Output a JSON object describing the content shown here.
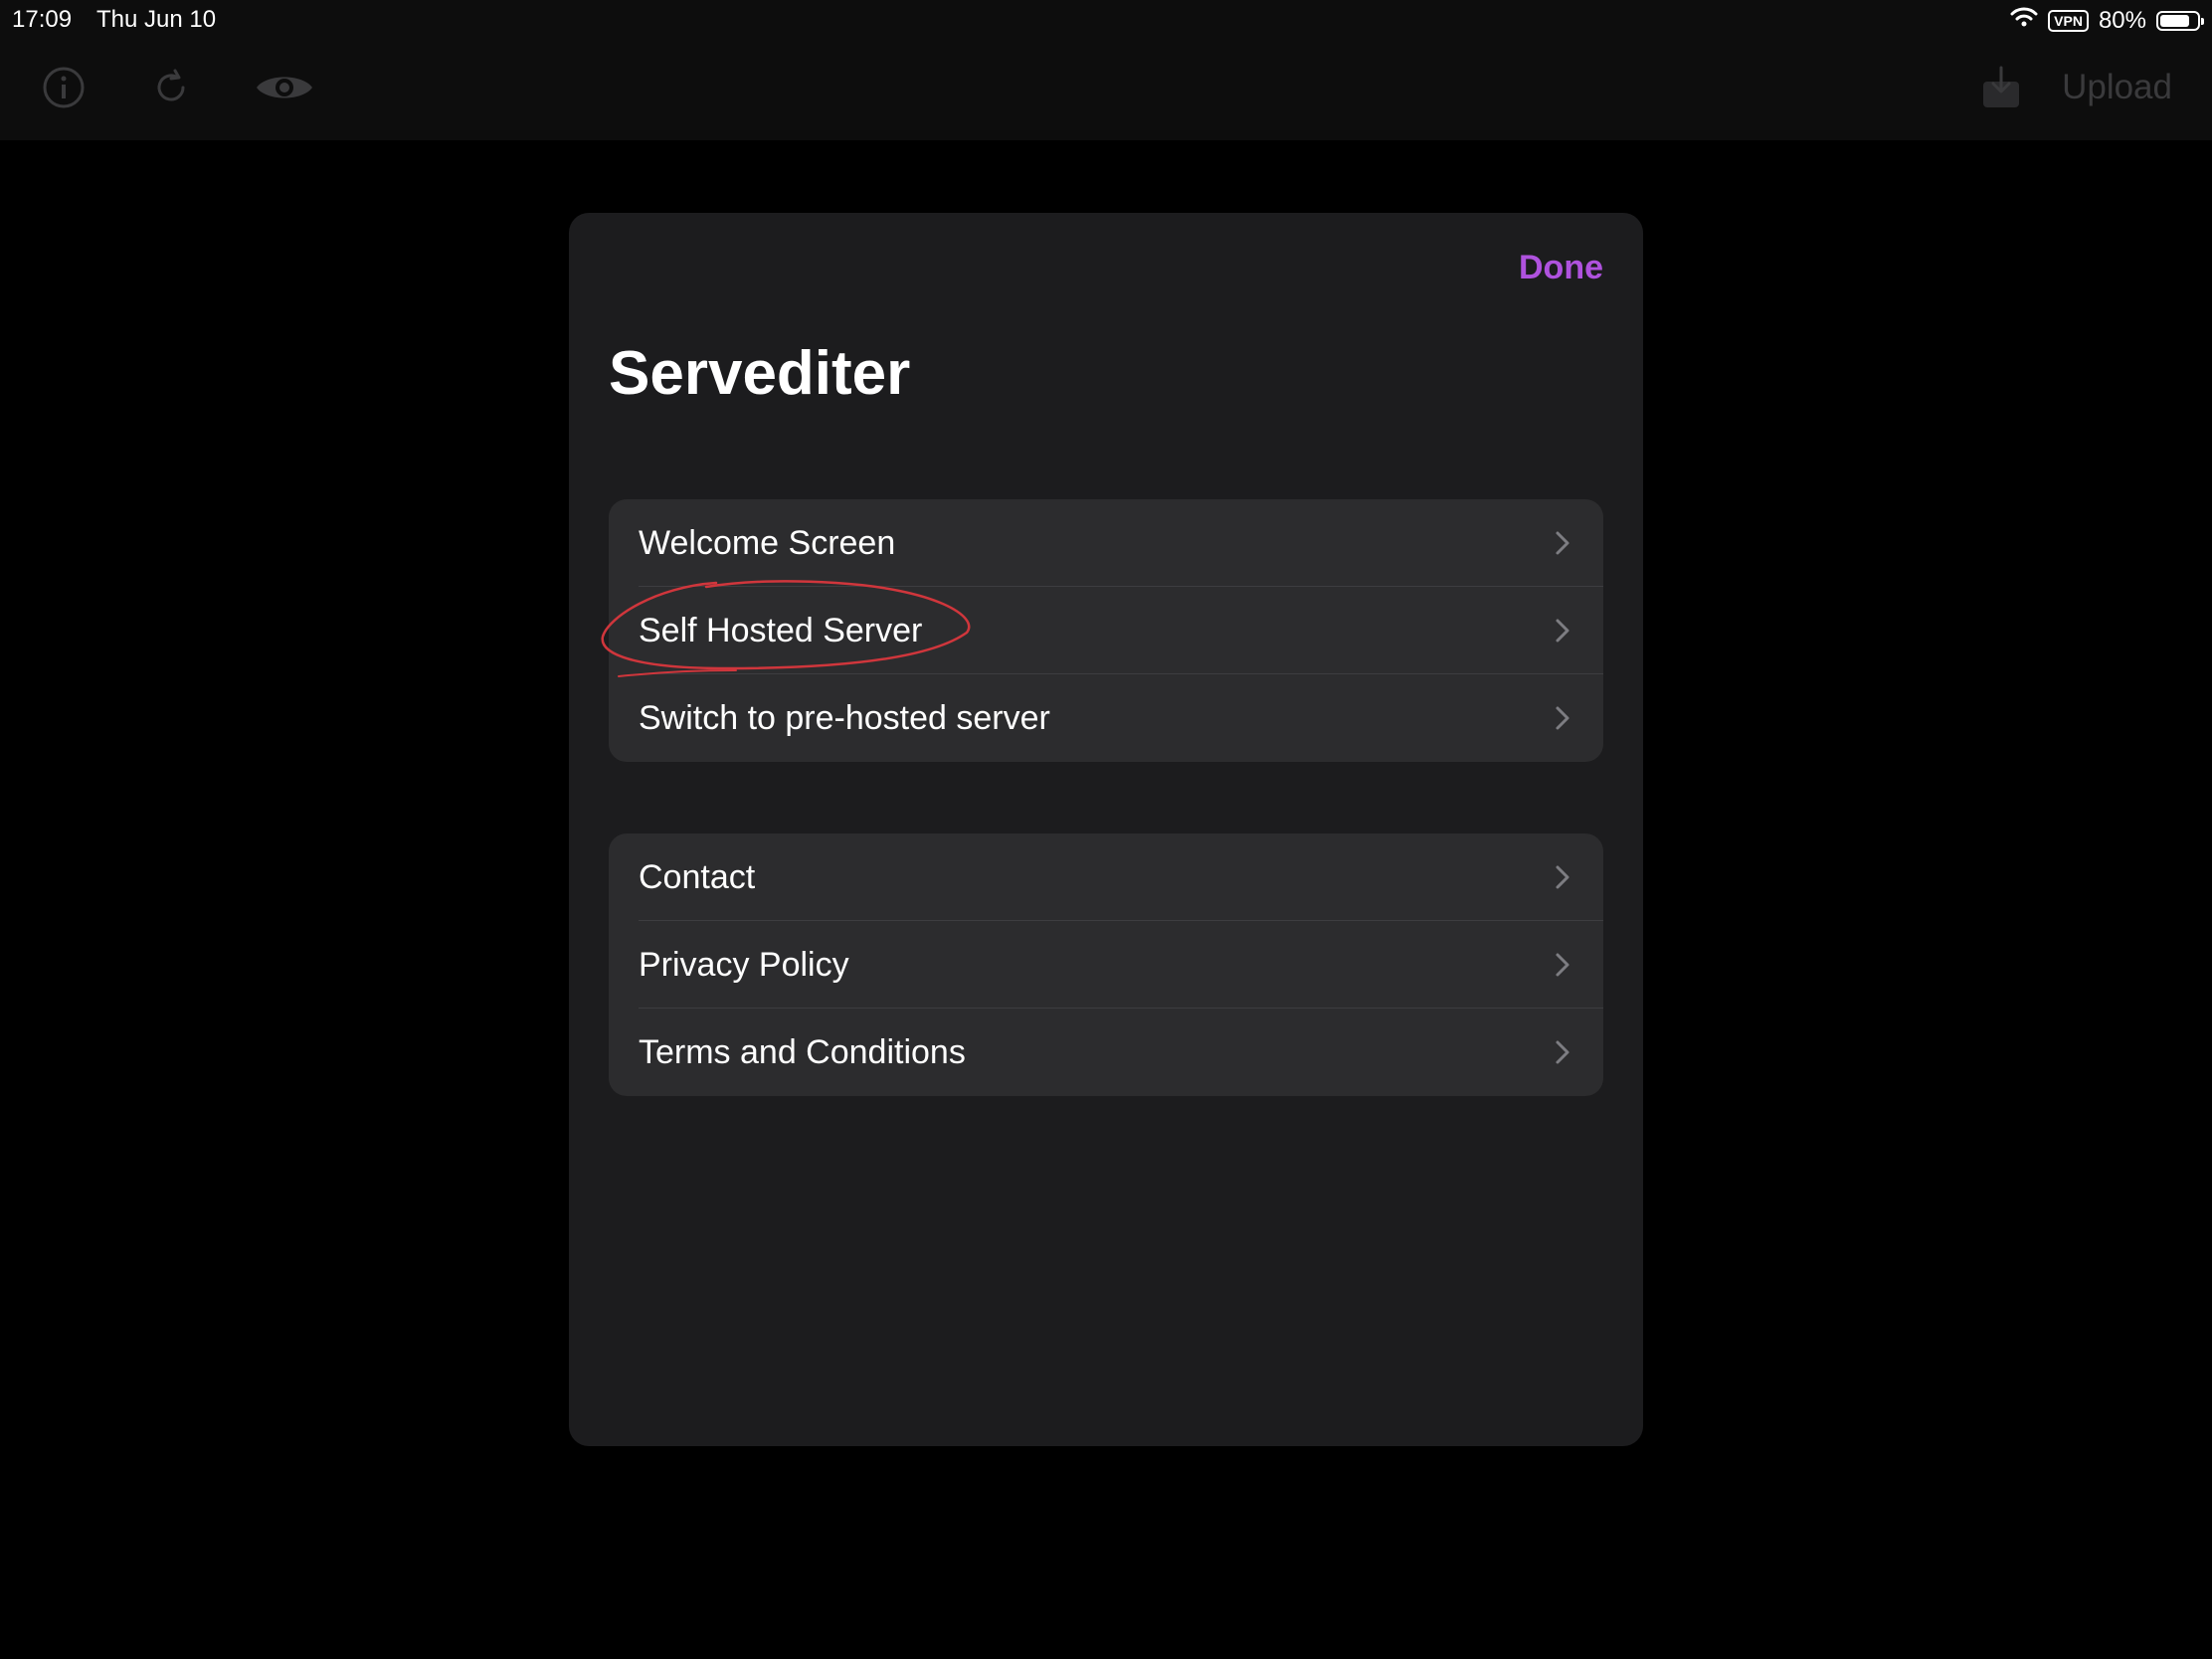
{
  "status_bar": {
    "time": "17:09",
    "date": "Thu Jun 10",
    "vpn": "VPN",
    "battery": "80%",
    "battery_level": 0.8
  },
  "toolbar": {
    "upload_label": "Upload",
    "icons": [
      "info-icon",
      "refresh-icon",
      "eye-icon",
      "download-icon"
    ]
  },
  "modal": {
    "done_label": "Done",
    "title": "Servediter",
    "groups": [
      {
        "items": [
          {
            "label": "Welcome Screen"
          },
          {
            "label": "Self Hosted Server"
          },
          {
            "label": "Switch to pre-hosted server"
          }
        ]
      },
      {
        "items": [
          {
            "label": "Contact"
          },
          {
            "label": "Privacy Policy"
          },
          {
            "label": "Terms and Conditions"
          }
        ]
      }
    ]
  },
  "colors": {
    "accent": "#af52de",
    "annotation": "#d0363c",
    "modal_bg": "#1c1c1e",
    "group_bg": "#2c2c2e"
  }
}
